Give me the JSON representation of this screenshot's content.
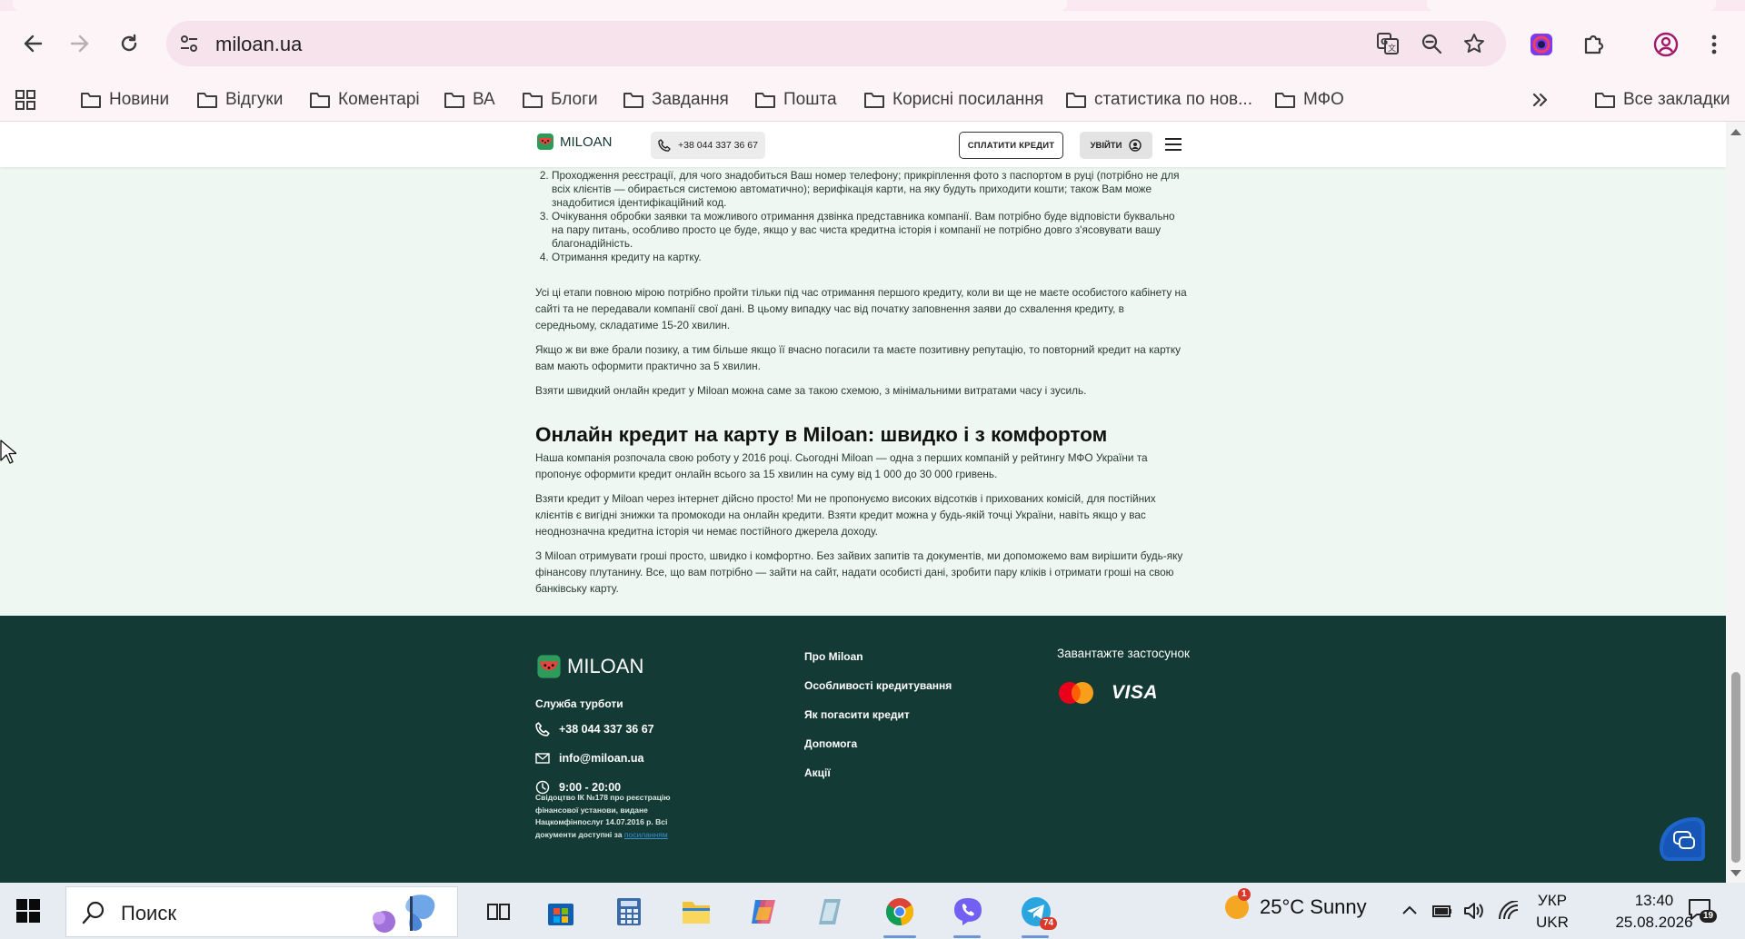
{
  "browser": {
    "url": "miloan.ua",
    "bookmarks": [
      "Новини",
      "Відгуки",
      "Коментарі",
      "ВА",
      "Блоги",
      "Завдання",
      "Пошта",
      "Корисні посилання",
      "статистика по нов...",
      "МФО"
    ],
    "all_bookmarks": "Все закладки"
  },
  "site_header": {
    "logo": "MILOAN",
    "phone": "+38 044 337 36 67",
    "pay_button": "СПЛАТИТИ КРЕДИТ",
    "login_button": "УВІЙТИ"
  },
  "article": {
    "steps": [
      "Проходження реєстрації, для чого знадобиться Ваш номер телефону; прикріплення фото з паспортом в руці (потрібно не для всіх клієнтів — обирається системою автоматично); верифікація карти, на яку будуть приходити кошти; також Вам може знадобитися ідентифікаційний код.",
      "Очікування обробки заявки та можливого отримання дзвінка представника компанії. Вам потрібно буде відповісти буквально на пару питань, особливо просто це буде, якщо у вас чиста кредитна історія і компанії не потрібно довго з'ясовувати вашу благонадійність.",
      "Отримання кредиту на картку."
    ],
    "para1": "Усі ці етапи повною мірою потрібно пройти тільки під час отримання першого кредиту, коли ви ще не маєте особистого кабінету на сайті та не передавали компанії свої дані. В цьому випадку час від початку заповнення заяви до схвалення кредиту, в середньому, складатиме 15-20 хвилин.",
    "para2": "Якщо ж ви вже брали позику, а тим більше якщо її вчасно погасили та маєте позитивну репутацію, то повторний кредит на картку вам мають оформити практично за 5 хвилин.",
    "para3": "Взяти швидкий онлайн кредит у Miloan можна саме за такою схемою, з мінімальними витратами часу і зусиль.",
    "heading": "Онлайн кредит на карту в Miloan: швидко і з комфортом",
    "para4": "Наша компанія розпочала свою роботу у 2016 році. Сьогодні Miloan — одна з перших компаній у рейтингу МФО України та пропонує оформити кредит онлайн всього за 15 хвилин на суму від 1 000 до 30 000 гривень.",
    "para5": "Взяти кредит у Miloan через інтернет дійсно просто! Ми не пропонуємо високих відсотків і прихованих комісій, для постійних клієнтів є вигідні знижки та промокоди на онлайн кредити. Взяти кредит можна у будь-якій точці України, навіть якщо у вас неоднозначна кредитна історія чи немає постійного джерела доходу.",
    "para6": "З Miloan отримувати гроші просто, швидко і комфортно. Без зайвих запитів та документів, ми допоможемо вам вирішити будь-яку фінансову плутанину. Все, що вам потрібно — зайти на сайт, надати особисті дані, зробити пару кліків і отримати гроші на свою банківську карту."
  },
  "footer": {
    "logo": "MILOAN",
    "service_label": "Служба турботи",
    "phone": "+38 044 337 36 67",
    "email": "info@miloan.ua",
    "hours": "9:00 - 20:00",
    "license_text": "Свідоцтво ІК №178 про реєстрацію фінансової установи, видане Нацкомфінпослуг 14.07.2016 р. Всі документи доступні за",
    "license_link": "посиланням",
    "nav": [
      "Про Miloan",
      "Особливості кредитування",
      "Як погасити кредит",
      "Допомога",
      "Акції"
    ],
    "app_label": "Завантажте застосунок",
    "visa": "VISA"
  },
  "taskbar": {
    "search_placeholder": "Поиск",
    "weather": "25°C  Sunny",
    "weather_badge": "1",
    "telegram_badge": "74",
    "lang_top": "УКР",
    "lang_bottom": "UKR",
    "time": "13:40",
    "date": "25.08.2026",
    "notifications": "19"
  },
  "colors": {
    "footer_bg": "#133a34",
    "page_bg": "#eef7f1",
    "brand_red": "#e8423c",
    "brand_green": "#2e9b5a"
  }
}
